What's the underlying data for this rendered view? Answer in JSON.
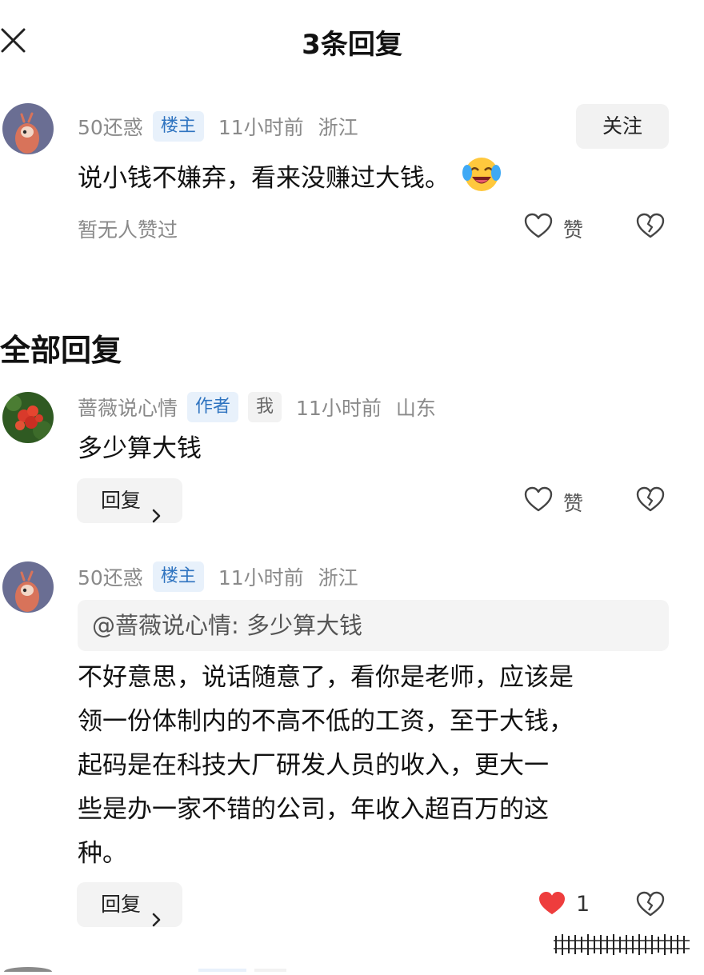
{
  "header": {
    "title": "3条回复",
    "close_icon": "close-icon"
  },
  "main_comment": {
    "username": "50还惑",
    "badge": "楼主",
    "time": "11小时前",
    "location": "浙江",
    "follow_label": "关注",
    "text": "说小钱不嫌弃，看来没赚过大钱。",
    "emoji": "laughing-crying-emoji-icon",
    "likes_status": "暂无人赞过",
    "like_label": "赞"
  },
  "section_title": "全部回复",
  "replies": [
    {
      "username": "蔷薇说心情",
      "badge": "作者",
      "badge2": "我",
      "time": "11小时前",
      "location": "山东",
      "text": "多少算大钱",
      "reply_label": "回复",
      "like_label": "赞"
    },
    {
      "username": "50还惑",
      "badge": "楼主",
      "time": "11小时前",
      "location": "浙江",
      "quote": "@蔷薇说心情: 多少算大钱",
      "lines": [
        "不好意思，说话随意了，看你是老师，应该是",
        "领一份体制内的不高不低的工资，至于大钱，",
        "起码是在科技大厂研发人员的收入，更大一",
        "些是办一家不错的公司，年收入超百万的这",
        "种。"
      ],
      "reply_label": "回复",
      "like_count": "1",
      "liked": true
    }
  ],
  "colors": {
    "badge_blue": "#2f74c0",
    "like_red": "#ee3d3d",
    "meta_grey": "#8a8a8a"
  }
}
